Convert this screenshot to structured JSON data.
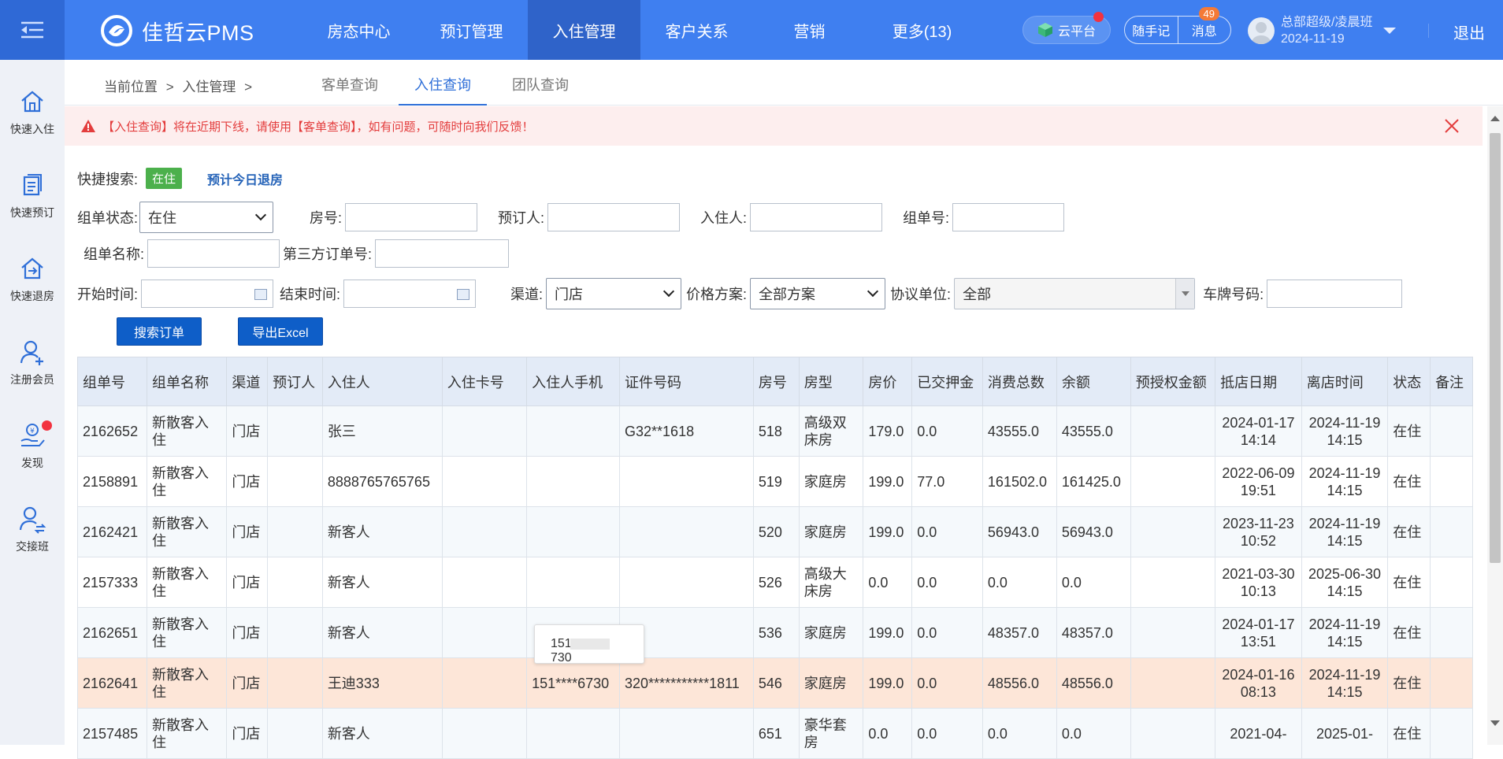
{
  "header": {
    "app_name": "佳哲云PMS",
    "nav": [
      "房态中心",
      "预订管理",
      "入住管理",
      "客户关系",
      "营销",
      "更多(13)"
    ],
    "cloud_label": "云平台",
    "notes_label": "随手记",
    "msg_label": "消息",
    "msg_badge": "49",
    "user_name": "总部超级/凌晨班",
    "user_date": "2024-11-19",
    "logout_label": "退出"
  },
  "sidebar": {
    "items": [
      "快速入住",
      "快速预订",
      "快速退房",
      "注册会员",
      "发现",
      "交接班"
    ]
  },
  "crumb": {
    "current_position": "当前位置",
    "sep": ">",
    "section": "入住管理",
    "tabs": [
      "客单查询",
      "入住查询",
      "团队查询"
    ]
  },
  "alert": {
    "text": "【入住查询】将在近期下线，请使用【客单查询】，如有问题，可随时向我们反馈！"
  },
  "filters": {
    "quick_label": "快捷搜索:",
    "quick_tag": "在住",
    "quick_link": "预计今日退房",
    "status_label": "组单状态:",
    "status_value": "在住",
    "room_label": "房号:",
    "booker_label": "预订人:",
    "guest_label": "入住人:",
    "group_no_label": "组单号:",
    "group_name_label": "组单名称:",
    "third_party_label": "第三方订单号:",
    "start_label": "开始时间:",
    "end_label": "结束时间:",
    "channel_label": "渠道:",
    "channel_value": "门店",
    "price_label": "价格方案:",
    "price_value": "全部方案",
    "agreement_label": "协议单位:",
    "agreement_value": "全部",
    "plate_label": "车牌号码:",
    "search_btn": "搜索订单",
    "export_btn": "导出Excel"
  },
  "table": {
    "headers": [
      "组单号",
      "组单名称",
      "渠道",
      "预订人",
      "入住人",
      "入住卡号",
      "入住人手机",
      "证件号码",
      "房号",
      "房型",
      "房价",
      "已交押金",
      "消费总数",
      "余额",
      "预授权金额",
      "抵店日期",
      "离店时间",
      "状态",
      "备注"
    ],
    "rows": [
      [
        "2162652",
        "新散客入住",
        "门店",
        "",
        "张三",
        "",
        "",
        "G32**1618",
        "518",
        "高级双床房",
        "179.0",
        "0.0",
        "43555.0",
        "43555.0",
        "",
        "2024-01-17 14:14",
        "2024-11-19 14:15",
        "在住",
        ""
      ],
      [
        "2158891",
        "新散客入住",
        "门店",
        "",
        "8888765765765",
        "",
        "",
        "",
        "519",
        "家庭房",
        "199.0",
        "77.0",
        "161502.0",
        "161425.0",
        "",
        "2022-06-09 19:51",
        "2024-11-19 14:15",
        "在住",
        ""
      ],
      [
        "2162421",
        "新散客入住",
        "门店",
        "",
        "新客人",
        "",
        "",
        "",
        "520",
        "家庭房",
        "199.0",
        "0.0",
        "56943.0",
        "56943.0",
        "",
        "2023-11-23 10:52",
        "2024-11-19 14:15",
        "在住",
        ""
      ],
      [
        "2157333",
        "新散客入住",
        "门店",
        "",
        "新客人",
        "",
        "",
        "",
        "526",
        "高级大床房",
        "0.0",
        "0.0",
        "0.0",
        "0.0",
        "",
        "2021-03-30 10:13",
        "2025-06-30 14:15",
        "在住",
        ""
      ],
      [
        "2162651",
        "新散客入住",
        "门店",
        "",
        "新客人",
        "",
        "",
        "",
        "536",
        "家庭房",
        "199.0",
        "0.0",
        "48357.0",
        "48357.0",
        "",
        "2024-01-17 13:51",
        "2024-11-19 14:15",
        "在住",
        ""
      ],
      [
        "2162641",
        "新散客入住",
        "门店",
        "",
        "王迪333",
        "",
        "151****6730",
        "320***********1811",
        "546",
        "家庭房",
        "199.0",
        "0.0",
        "48556.0",
        "48556.0",
        "",
        "2024-01-16 08:13",
        "2024-11-19 14:15",
        "在住",
        ""
      ],
      [
        "2157485",
        "新散客入住",
        "门店",
        "",
        "新客人",
        "",
        "",
        "",
        "651",
        "豪华套房",
        "0.0",
        "0.0",
        "0.0",
        "0.0",
        "",
        "2021-04-",
        "2025-01-",
        "在住",
        ""
      ]
    ]
  },
  "tooltip": {
    "prefix": "151",
    "suffix": "730"
  }
}
